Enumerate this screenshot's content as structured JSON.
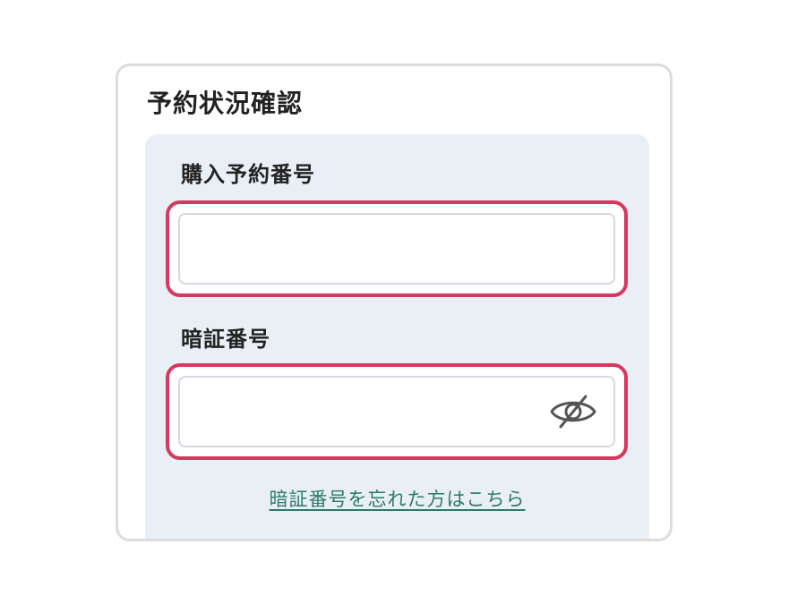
{
  "card": {
    "title": "予約状況確認"
  },
  "reservation_field": {
    "label": "購入予約番号",
    "value": "",
    "placeholder": ""
  },
  "pin_field": {
    "label": "暗証番号",
    "value": "",
    "placeholder": "",
    "toggle_icon": "eye-slash-icon"
  },
  "forgot_link": {
    "label": "暗証番号を忘れた方はこちら"
  },
  "colors": {
    "focus_ring": "#d7385e",
    "panel_bg": "#eaeff5",
    "link": "#2b7a6a"
  }
}
